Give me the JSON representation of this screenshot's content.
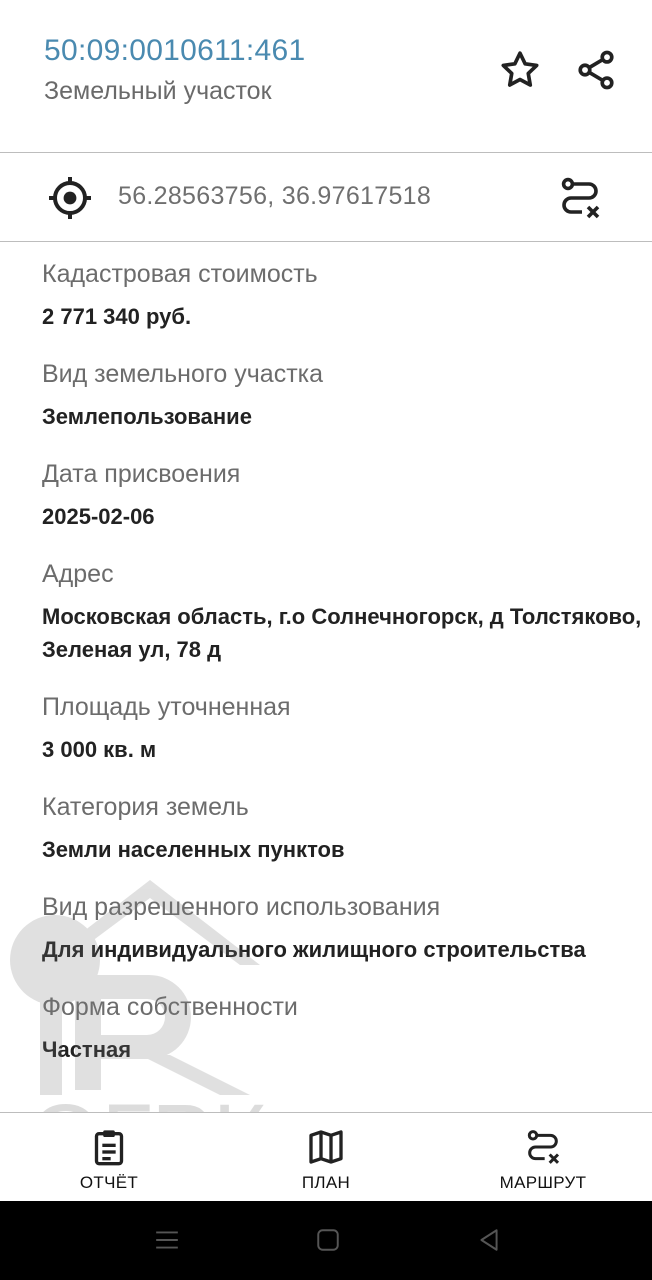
{
  "header": {
    "cadastral_number": "50:09:0010611:461",
    "object_type": "Земельный участок",
    "favorite_icon": "star-icon",
    "share_icon": "share-icon"
  },
  "coordinates": {
    "text": "56.28563756, 36.97617518",
    "locate_icon": "crosshair-icon",
    "route_icon": "route-clear-icon"
  },
  "details": [
    {
      "label": "Кадастровая стоимость",
      "value": "2 771 340 руб."
    },
    {
      "label": "Вид земельного участка",
      "value": "Землепользование"
    },
    {
      "label": "Дата присвоения",
      "value": "2025-02-06"
    },
    {
      "label": "Адрес",
      "value": "Московская область, г.о Солнечногорск, д Толстяково, Зеленая ул, 78 д"
    },
    {
      "label": "Площадь уточненная",
      "value": "3 000 кв. м"
    },
    {
      "label": "Категория земель",
      "value": "Земли населенных пунктов"
    },
    {
      "label": "Вид разрешенного использования",
      "value": "Для индивидуального жилищного строительства"
    },
    {
      "label": "Форма собственности",
      "value": "Частная"
    }
  ],
  "watermark": {
    "text": "ОГРК"
  },
  "bottom_nav": {
    "report_label": "ОТЧЁТ",
    "plan_label": "ПЛАН",
    "route_label": "МАРШРУТ"
  },
  "colors": {
    "accent": "#4a8ab0",
    "label_gray": "#6c6c6c",
    "divider": "#bdbdbd",
    "system_bar": "#000000"
  }
}
